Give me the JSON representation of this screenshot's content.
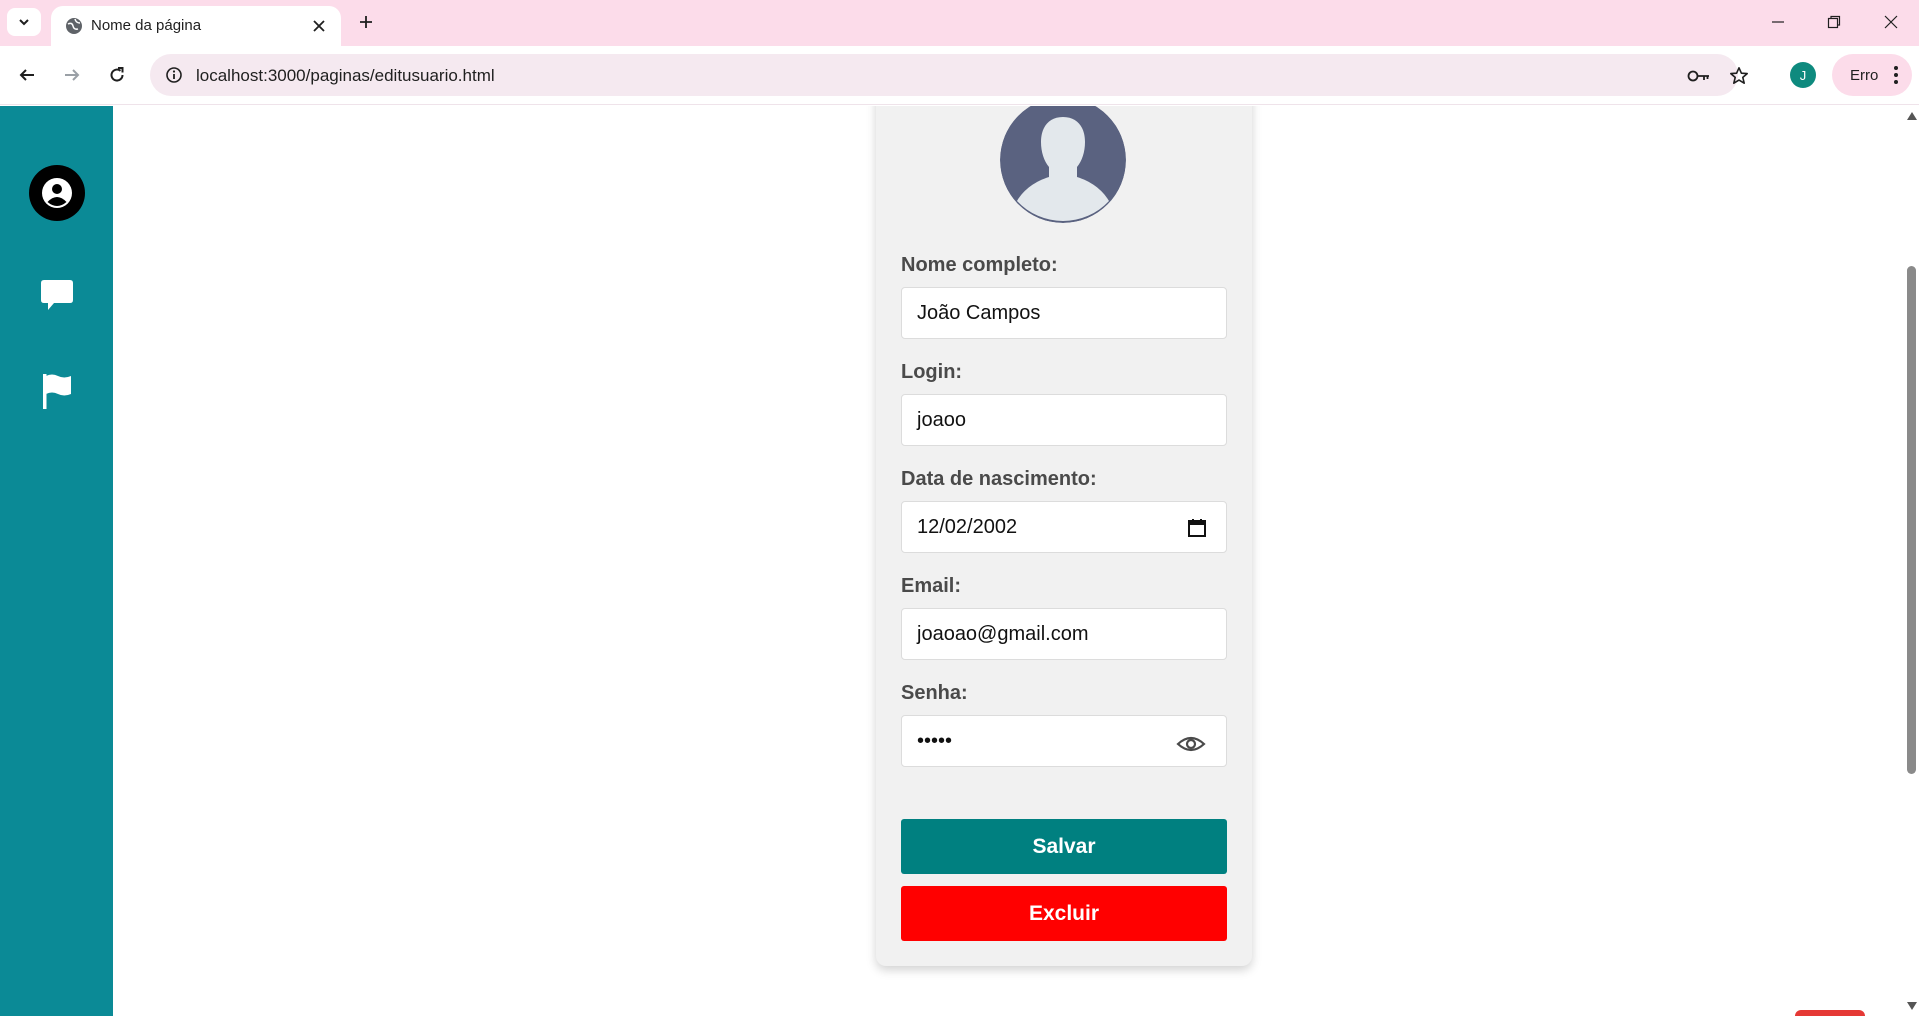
{
  "browser": {
    "tab_title": "Nome da página",
    "url": "localhost:3000/paginas/editusuario.html",
    "profile_initial": "J",
    "error_label": "Erro",
    "icons": {
      "tab_search": "chevron-down-icon",
      "favicon": "globe-icon",
      "close_tab": "close-icon",
      "new_tab": "plus-icon",
      "back": "arrow-left-icon",
      "forward": "arrow-right-icon",
      "reload": "reload-icon",
      "site_info": "info-icon",
      "passwords": "key-icon",
      "bookmark": "star-icon",
      "menu": "kebab-icon"
    }
  },
  "sidebar": {
    "items": [
      {
        "icon": "user-icon"
      },
      {
        "icon": "chat-icon"
      },
      {
        "icon": "flag-icon"
      }
    ],
    "color": "#0b8a96"
  },
  "form": {
    "fields": [
      {
        "label": "Nome completo:",
        "value": "João Campos"
      },
      {
        "label": "Login:",
        "value": "joaoo"
      },
      {
        "label": "Data de nascimento:",
        "value": "12/02/2002"
      },
      {
        "label": "Email:",
        "value": "joaoao@gmail.com"
      },
      {
        "label": "Senha:",
        "value": "•••••"
      }
    ],
    "save_label": "Salvar",
    "delete_label": "Excluir",
    "save_color": "#008080",
    "delete_color": "#ff0000"
  }
}
